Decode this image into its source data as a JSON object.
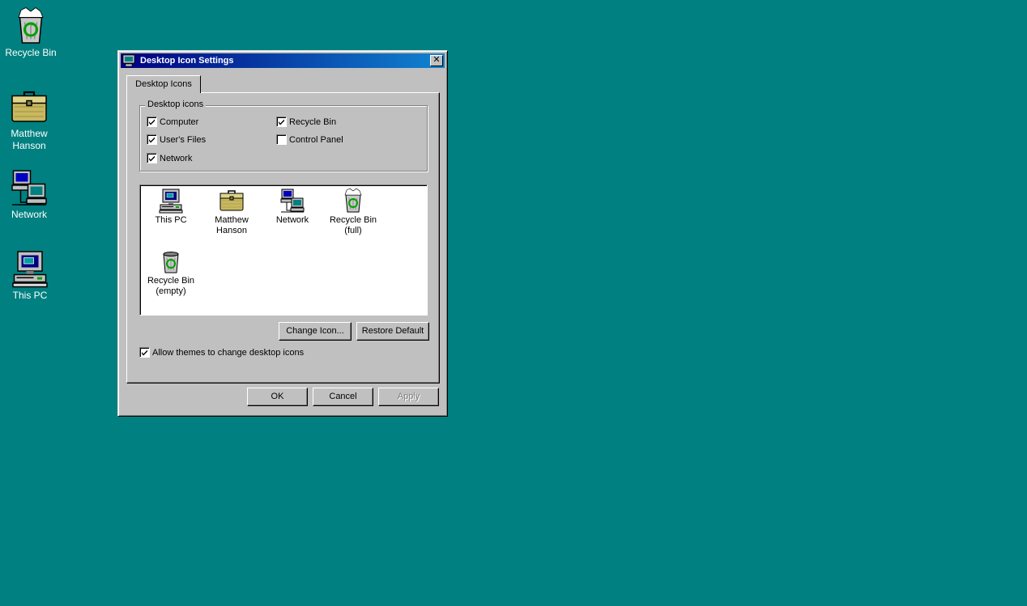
{
  "desktop": {
    "icons": [
      {
        "label": "Recycle Bin",
        "icon": "recycle-bin-full-icon"
      },
      {
        "label": "Matthew\nHanson",
        "icon": "briefcase-user-files-icon"
      },
      {
        "label": "Network",
        "icon": "network-computers-icon"
      },
      {
        "label": "This PC",
        "icon": "computer-icon"
      }
    ]
  },
  "window": {
    "title": "Desktop Icon Settings",
    "close_glyph": "✕",
    "tab_label": "Desktop Icons",
    "group_label": "Desktop icons",
    "checkboxes": {
      "computer": {
        "label": "Computer",
        "checked": true
      },
      "users_files": {
        "label": "User's Files",
        "checked": true
      },
      "network": {
        "label": "Network",
        "checked": true
      },
      "recycle_bin": {
        "label": "Recycle Bin",
        "checked": true
      },
      "control_panel": {
        "label": "Control Panel",
        "checked": false
      }
    },
    "icon_list": [
      {
        "line1": "This PC",
        "line2": "",
        "icon": "computer-icon"
      },
      {
        "line1": "Matthew",
        "line2": "Hanson",
        "icon": "briefcase-user-files-icon"
      },
      {
        "line1": "Network",
        "line2": "",
        "icon": "network-computers-icon"
      },
      {
        "line1": "Recycle Bin",
        "line2": "(full)",
        "icon": "recycle-bin-full-icon"
      },
      {
        "line1": "Recycle Bin",
        "line2": "(empty)",
        "icon": "recycle-bin-empty-icon"
      }
    ],
    "change_icon_label": "Change Icon...",
    "restore_default_label": "Restore Default",
    "allow_themes": {
      "label": "Allow themes to change desktop icons",
      "checked": true
    },
    "ok_label": "OK",
    "cancel_label": "Cancel",
    "apply_label": "Apply"
  },
  "colors": {
    "desktop": "#008080",
    "face": "#c0c0c0",
    "title_start": "#000080",
    "title_end": "#1084d0"
  }
}
